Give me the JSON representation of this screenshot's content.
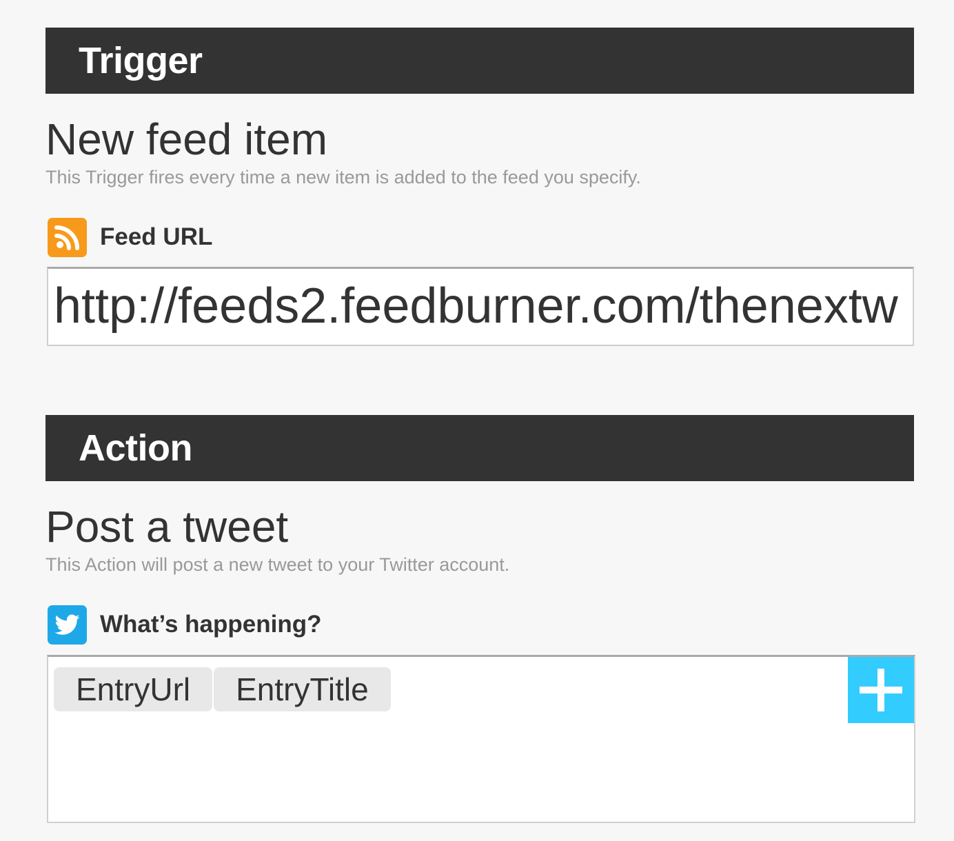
{
  "trigger": {
    "section_title": "Trigger",
    "title": "New feed item",
    "description": "This Trigger fires every time a new item is added to the feed you specify.",
    "field": {
      "icon": "rss-icon",
      "label": "Feed URL",
      "value": "http://feeds2.feedburner.com/thenextw"
    }
  },
  "action": {
    "section_title": "Action",
    "title": "Post a tweet",
    "description": "This Action will post a new tweet to your Twitter account.",
    "field": {
      "icon": "twitter-icon",
      "label": "What’s happening?",
      "ingredients": [
        "EntryUrl",
        "EntryTitle"
      ],
      "add_button_icon": "plus-icon"
    }
  },
  "colors": {
    "section_bar": "#333333",
    "rss_icon": "#f79a1b",
    "twitter_icon": "#1ea8e8",
    "add_button": "#33ccff",
    "pill": "#e8e8e8"
  }
}
